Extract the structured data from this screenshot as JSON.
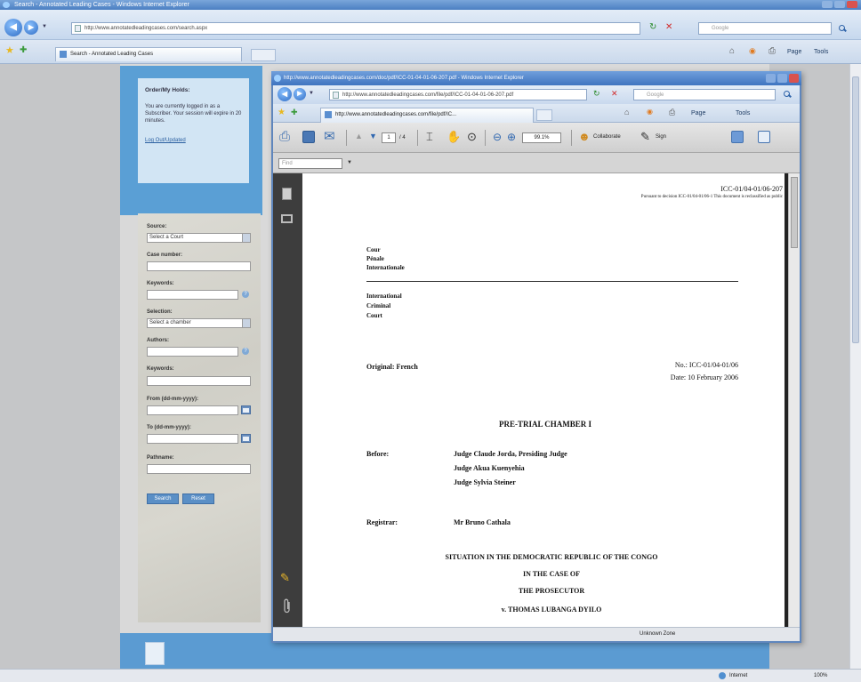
{
  "main": {
    "title": "Search - Annotated Leading Cases - Windows Internet Explorer",
    "address": "http://www.annotatedleadingcases.com/search.aspx",
    "search_placeholder": "Google",
    "tab": "Search - Annotated Leading Cases",
    "page_menu": "Page",
    "tools_menu": "Tools",
    "status_zone": "Internet",
    "status_zoom": "100%"
  },
  "login_box": {
    "title": "Order/My Holds:",
    "text": "You are currently logged in as a Subscriber. Your session will expire in 20 minutes.",
    "link": "Log Out/Updated"
  },
  "search_form": {
    "source_label": "Source:",
    "source_value": "Select a Court",
    "case_label": "Case number:",
    "keywords_label": "Keywords:",
    "selection_label": "Selection:",
    "selection_value": "Select a chamber",
    "authors_label": "Authors:",
    "keywords2_label": "Keywords:",
    "from_label": "From (dd-mm-yyyy):",
    "to_label": "To (dd-mm-yyyy):",
    "pathname_label": "Pathname:",
    "search_button": "Search",
    "reset_button": "Reset"
  },
  "popup": {
    "title": "http://www.annotatedleadingcases.com/doc/pdf/ICC-01-04-01-06-207.pdf - Windows Internet Explorer",
    "address": "http://www.annotatedleadingcases.com/file/pdf/ICC-01-04-01-06-207.pdf",
    "search_placeholder": "Google",
    "tab": "http://www.annotatedleadingcases.com/file/pdf/IC...",
    "page_menu": "Page",
    "tools_menu": "Tools",
    "status_zone": "Unknown Zone"
  },
  "pdf_toolbar": {
    "page_current": "1",
    "page_total": "/ 4",
    "zoom": "99.1%",
    "collaborate": "Collaborate",
    "sign": "Sign",
    "find_placeholder": "Find"
  },
  "pdf_page": {
    "doc_number": "ICC-01/04-01/06-207",
    "reclass_note": "Pursuant to decision ICC-01/04-01/06-1 This document is reclassified as public",
    "court_fr": [
      "Cour",
      "Pénale",
      "Internationale"
    ],
    "court_en": [
      "International",
      "Criminal",
      "Court"
    ],
    "original": "Original: French",
    "no": "No.: ICC-01/04-01/06",
    "date": "Date: 10 February 2006",
    "chamber": "PRE-TRIAL CHAMBER I",
    "before_label": "Before:",
    "judges": [
      "Judge Claude Jorda, Presiding Judge",
      "Judge Akua Kuenyehia",
      "Judge Sylvia Steiner"
    ],
    "registrar_label": "Registrar:",
    "registrar": "Mr Bruno Cathala",
    "situation": "SITUATION IN THE DEMOCRATIC REPUBLIC OF THE CONGO",
    "case_of": "IN THE CASE OF",
    "prosecutor": "THE PROSECUTOR",
    "accused": "v. THOMAS LUBANGA DYILO"
  },
  "colors": {
    "ie_chrome": "#c6d8ee",
    "site_blue": "#5a9fd5",
    "pdf_sidebar": "#3d3d3d"
  },
  "icons": [
    "back-icon",
    "forward-icon",
    "refresh-icon",
    "stop-icon",
    "search-icon",
    "favorites-star-icon",
    "add-favorites-icon",
    "home-icon",
    "feeds-icon",
    "print-icon",
    "save-icon",
    "email-icon",
    "page-up-icon",
    "page-down-icon",
    "select-icon",
    "hand-icon",
    "zoom-out-icon",
    "zoom-in-icon",
    "sign-pen-icon",
    "paperclip-icon",
    "pages-panel-icon",
    "help-icon",
    "calendar-icon"
  ]
}
